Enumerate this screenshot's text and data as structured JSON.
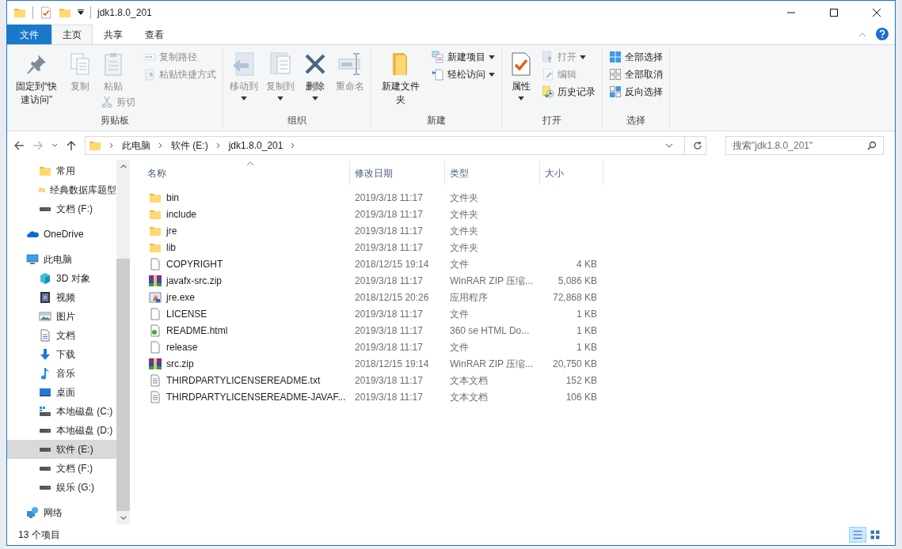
{
  "window": {
    "title": "jdk1.8.0_201"
  },
  "ribbon_tabs": [
    {
      "label": "文件",
      "kind": "file",
      "selected": false
    },
    {
      "label": "主页",
      "kind": "tab",
      "selected": true
    },
    {
      "label": "共享",
      "kind": "tab",
      "selected": false
    },
    {
      "label": "查看",
      "kind": "tab",
      "selected": false
    }
  ],
  "ribbon_groups": [
    {
      "label": "剪贴板",
      "columns": [
        [
          {
            "label": "固定到“快速访问”",
            "kind": "pin",
            "large": true,
            "disabled": false,
            "dropdown": false
          }
        ],
        [
          {
            "label": "复制",
            "kind": "copy",
            "large": true,
            "disabled": true,
            "dropdown": false
          }
        ],
        [
          {
            "label": "粘贴",
            "kind": "paste",
            "large": true,
            "disabled": true,
            "dropdown": false
          },
          {
            "label": "剪切",
            "kind": "cut",
            "large": false,
            "disabled": true,
            "dropdown": false
          }
        ],
        [
          {
            "label": "复制路径",
            "kind": "copy-path",
            "large": false,
            "disabled": true,
            "dropdown": false
          },
          {
            "label": "粘贴快捷方式",
            "kind": "paste-shortcut",
            "large": false,
            "disabled": true,
            "dropdown": false
          }
        ]
      ]
    },
    {
      "label": "组织",
      "columns": [
        [
          {
            "label": "移动到",
            "kind": "move",
            "large": true,
            "disabled": true,
            "dropdown": true
          }
        ],
        [
          {
            "label": "复制到",
            "kind": "copy-to",
            "large": true,
            "disabled": true,
            "dropdown": true
          }
        ],
        [
          {
            "label": "删除",
            "kind": "delete",
            "large": true,
            "disabled": false,
            "dropdown": true
          }
        ],
        [
          {
            "label": "重命名",
            "kind": "rename",
            "large": true,
            "disabled": true,
            "dropdown": false
          }
        ]
      ]
    },
    {
      "label": "新建",
      "columns": [
        [
          {
            "label": "新建文件夹",
            "kind": "new-folder",
            "large": true,
            "disabled": false,
            "dropdown": false
          }
        ],
        [
          {
            "label": "新建项目",
            "kind": "new-item",
            "large": false,
            "disabled": false,
            "dropdown": true
          },
          {
            "label": "轻松访问",
            "kind": "easy-access",
            "large": false,
            "disabled": false,
            "dropdown": true
          }
        ]
      ]
    },
    {
      "label": "打开",
      "columns": [
        [
          {
            "label": "属性",
            "kind": "properties",
            "large": true,
            "disabled": false,
            "dropdown": true
          }
        ],
        [
          {
            "label": "打开",
            "kind": "open",
            "large": false,
            "disabled": true,
            "dropdown": true
          },
          {
            "label": "编辑",
            "kind": "edit",
            "large": false,
            "disabled": true,
            "dropdown": false
          },
          {
            "label": "历史记录",
            "kind": "history",
            "large": false,
            "disabled": false,
            "dropdown": false
          }
        ]
      ]
    },
    {
      "label": "选择",
      "columns": [
        [
          {
            "label": "全部选择",
            "kind": "select-all",
            "large": false,
            "disabled": false,
            "dropdown": false
          },
          {
            "label": "全部取消",
            "kind": "select-none",
            "large": false,
            "disabled": false,
            "dropdown": false
          },
          {
            "label": "反向选择",
            "kind": "invert",
            "large": false,
            "disabled": false,
            "dropdown": false
          }
        ]
      ]
    }
  ],
  "navigation": {
    "back_disabled": false,
    "forward_disabled": true
  },
  "breadcrumb": [
    "此电脑",
    "软件 (E:)",
    "jdk1.8.0_201"
  ],
  "search": {
    "placeholder": "搜索\"jdk1.8.0_201\""
  },
  "sidebar": {
    "items": [
      {
        "children": [
          {
            "label": "常用",
            "kind": "folder",
            "selected": false
          },
          {
            "label": "经典数据库题型",
            "kind": "folder",
            "selected": false
          },
          {
            "label": "文档 (F:)",
            "kind": "drive",
            "selected": false
          }
        ]
      },
      {
        "label": "OneDrive",
        "kind": "cloud",
        "selected": false
      },
      {
        "label": "此电脑",
        "kind": "computer",
        "selected": false,
        "children": [
          {
            "label": "3D 对象",
            "kind": "objects3d",
            "selected": false
          },
          {
            "label": "视频",
            "kind": "videos",
            "selected": false
          },
          {
            "label": "图片",
            "kind": "pictures",
            "selected": false
          },
          {
            "label": "文档",
            "kind": "documents",
            "selected": false
          },
          {
            "label": "下载",
            "kind": "downloads",
            "selected": false
          },
          {
            "label": "音乐",
            "kind": "music",
            "selected": false
          },
          {
            "label": "桌面",
            "kind": "desktop",
            "selected": false
          },
          {
            "label": "本地磁盘 (C:)",
            "kind": "system-drive",
            "selected": false
          },
          {
            "label": "本地磁盘 (D:)",
            "kind": "drive",
            "selected": false
          },
          {
            "label": "软件 (E:)",
            "kind": "drive",
            "selected": true
          },
          {
            "label": "文档 (F:)",
            "kind": "drive",
            "selected": false
          },
          {
            "label": "娱乐 (G:)",
            "kind": "drive",
            "selected": false
          }
        ]
      },
      {
        "label": "网络",
        "kind": "network",
        "selected": false
      }
    ]
  },
  "table": {
    "columns": [
      {
        "label": "名称",
        "sorted": true
      },
      {
        "label": "修改日期",
        "sorted": false
      },
      {
        "label": "类型",
        "sorted": false
      },
      {
        "label": "大小",
        "sorted": false
      }
    ],
    "rows": [
      {
        "name": "bin",
        "date": "2019/3/18 11:17",
        "type": "文件夹",
        "kind": "folder"
      },
      {
        "name": "include",
        "date": "2019/3/18 11:17",
        "type": "文件夹",
        "kind": "folder"
      },
      {
        "name": "jre",
        "date": "2019/3/18 11:17",
        "type": "文件夹",
        "kind": "folder"
      },
      {
        "name": "lib",
        "date": "2019/3/18 11:17",
        "type": "文件夹",
        "kind": "folder"
      },
      {
        "name": "COPYRIGHT",
        "date": "2018/12/15 19:14",
        "type": "文件",
        "size": "4 KB",
        "kind": "file"
      },
      {
        "name": "javafx-src.zip",
        "date": "2019/3/18 11:17",
        "type": "WinRAR ZIP 压缩...",
        "size": "5,086 KB",
        "kind": "zip"
      },
      {
        "name": "jre.exe",
        "date": "2018/12/15 20:26",
        "type": "应用程序",
        "size": "72,868 KB",
        "kind": "exe"
      },
      {
        "name": "LICENSE",
        "date": "2019/3/18 11:17",
        "type": "文件",
        "size": "1 KB",
        "kind": "file"
      },
      {
        "name": "README.html",
        "date": "2019/3/18 11:17",
        "type": "360 se HTML Do...",
        "size": "1 KB",
        "kind": "html"
      },
      {
        "name": "release",
        "date": "2019/3/18 11:17",
        "type": "文件",
        "size": "1 KB",
        "kind": "file"
      },
      {
        "name": "src.zip",
        "date": "2018/12/15 19:14",
        "type": "WinRAR ZIP 压缩...",
        "size": "20,750 KB",
        "kind": "zip"
      },
      {
        "name": "THIRDPARTYLICENSEREADME.txt",
        "date": "2019/3/18 11:17",
        "type": "文本文档",
        "size": "152 KB",
        "kind": "text"
      },
      {
        "name": "THIRDPARTYLICENSEREADME-JAVAF...",
        "date": "2019/3/18 11:17",
        "type": "文本文档",
        "size": "106 KB",
        "kind": "text"
      }
    ]
  },
  "status_bar": {
    "count": "13 个项目",
    "views": [
      {
        "kind": "details",
        "selected": true
      },
      {
        "kind": "tiles",
        "selected": false
      }
    ]
  }
}
